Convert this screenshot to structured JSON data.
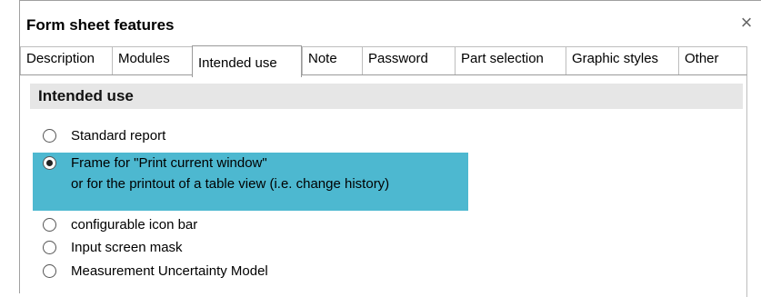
{
  "dialog": {
    "title": "Form sheet features",
    "close_glyph": "×"
  },
  "tabs": [
    {
      "label": "Description"
    },
    {
      "label": "Modules"
    },
    {
      "label": "Intended use"
    },
    {
      "label": "Note"
    },
    {
      "label": "Password"
    },
    {
      "label": "Part selection"
    },
    {
      "label": "Graphic styles"
    },
    {
      "label": "Other"
    }
  ],
  "active_tab": "Intended use",
  "section": {
    "title": "Intended use"
  },
  "options": [
    {
      "label": "Standard report",
      "checked": false
    },
    {
      "label": "Frame for \"Print current window\"",
      "label2": "or for the printout of a table view (i.e. change history)",
      "checked": true
    },
    {
      "label": "configurable icon bar",
      "checked": false
    },
    {
      "label": "Input screen mask",
      "checked": false
    },
    {
      "label": "Measurement Uncertainty Model",
      "checked": false
    }
  ],
  "colors": {
    "selection_highlight": "#4db8d0",
    "section_header_bg": "#e6e6e6"
  }
}
